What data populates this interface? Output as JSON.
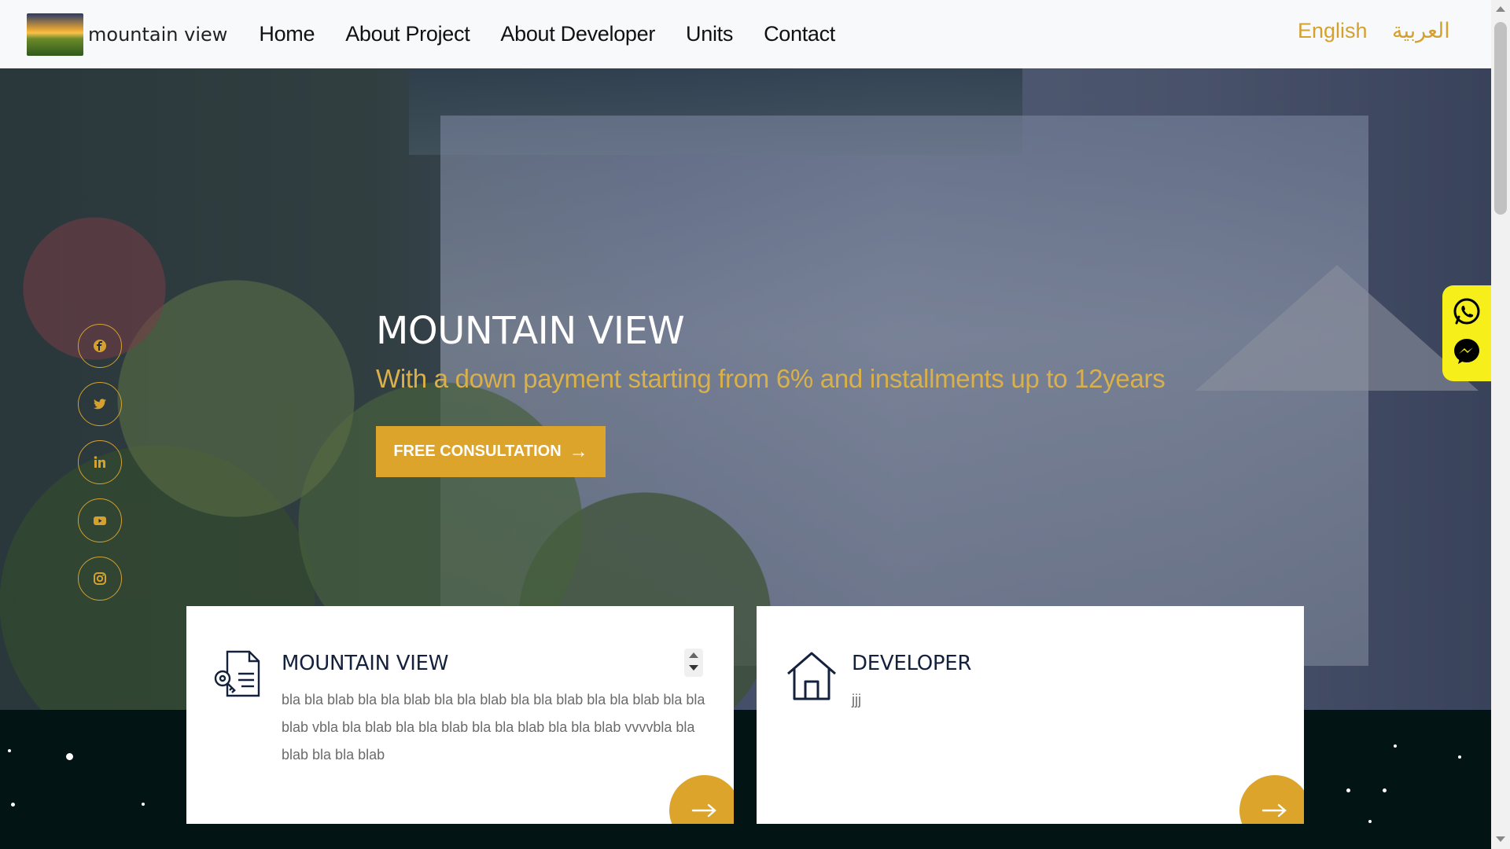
{
  "brand": {
    "name": "mountain view",
    "logo_icon": "landscape-logo"
  },
  "nav": {
    "links": [
      {
        "label": "Home"
      },
      {
        "label": "About Project"
      },
      {
        "label": "About Developer"
      },
      {
        "label": "Units"
      },
      {
        "label": "Contact"
      }
    ],
    "languages": [
      "English",
      "العربية"
    ]
  },
  "hero": {
    "title": "MOUNTAIN VIEW",
    "subtitle": "With a down payment starting from 6% and installments up to 12years",
    "cta_label": "FREE CONSULTATION"
  },
  "social": [
    {
      "name": "facebook-icon"
    },
    {
      "name": "twitter-icon"
    },
    {
      "name": "linkedin-icon"
    },
    {
      "name": "youtube-icon"
    },
    {
      "name": "instagram-icon"
    }
  ],
  "floating_chat": [
    {
      "name": "whatsapp-icon"
    },
    {
      "name": "messenger-icon"
    }
  ],
  "cards": [
    {
      "title": "MOUNTAIN VIEW",
      "text": "bla bla blab bla bla blab bla bla blab bla bla blab bla bla blab bla bla blab vbla bla blab bla bla blab bla bla blab bla bla blab vvvvbla bla blab bla bla blab",
      "icon": "document-key-icon"
    },
    {
      "title": "DEVELOPER",
      "text": "jjj",
      "icon": "house-icon"
    }
  ],
  "colors": {
    "accent": "#dca42a",
    "navbar_bg": "#f8f9fa",
    "dark_bg": "#031414",
    "chat_bg": "#f6ef1a",
    "heading": "#14213d"
  }
}
